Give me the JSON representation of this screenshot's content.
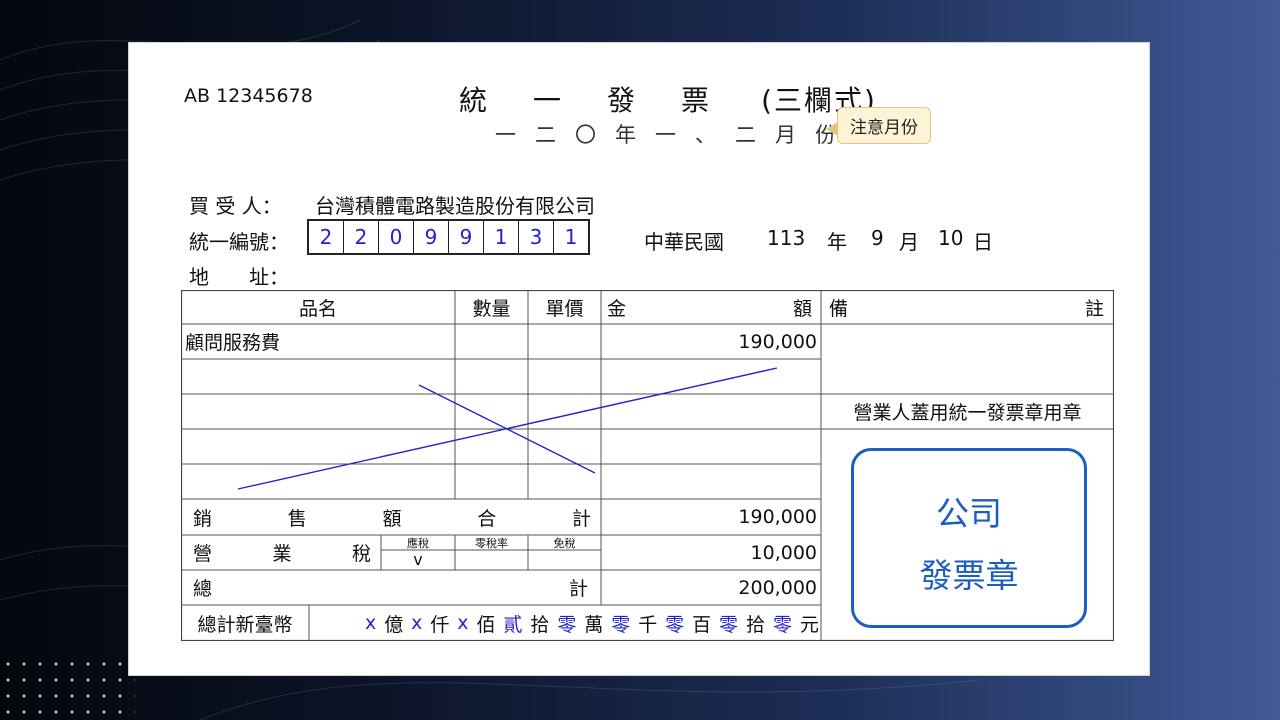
{
  "invoice": {
    "serial": "AB 12345678",
    "title_chars": [
      "統",
      "一",
      "發",
      "票"
    ],
    "title_suffix": "(三欄式)",
    "period": "一二〇年一、二月份",
    "note_tag": "注意月份"
  },
  "buyer": {
    "buyer_label": "買 受 人：",
    "buyer_name": "台灣積體電路製造股份有限公司",
    "tax_id_label": "統一編號：",
    "tax_id_digits": [
      "2",
      "2",
      "0",
      "9",
      "9",
      "1",
      "3",
      "1"
    ],
    "date_label": "中華民國",
    "year": "113",
    "year_unit": "年",
    "month": "9",
    "month_unit": "月",
    "day": "10",
    "day_unit": "日",
    "address_label": "地　　址："
  },
  "table": {
    "headers": {
      "item": "品名",
      "qty": "數量",
      "unit_price": "單價",
      "amount_left": "金",
      "amount_right": "額",
      "remark_left": "備",
      "remark_right": "註"
    },
    "rows": [
      {
        "item": "顧問服務費",
        "amount": "190,000"
      }
    ],
    "stamp_note": "營業人蓋用統一發票章用章",
    "sales_total_chars": [
      "銷",
      "售",
      "額",
      "合",
      "計"
    ],
    "sales_total": "190,000",
    "tax_label_chars": [
      "營",
      "業",
      "稅"
    ],
    "tax_types": [
      "應稅",
      "零稅率",
      "免稅"
    ],
    "tax_type_mark": "v",
    "tax_amount": "10,000",
    "grand_total_left": "總",
    "grand_total_right": "計",
    "grand_total": "200,000",
    "amount_words_label": "總計新臺幣",
    "amount_words": [
      {
        "digit": "x",
        "unit": "億"
      },
      {
        "digit": "x",
        "unit": "仟"
      },
      {
        "digit": "x",
        "unit": "佰"
      },
      {
        "digit": "貳",
        "unit": "拾"
      },
      {
        "digit": "零",
        "unit": "萬"
      },
      {
        "digit": "零",
        "unit": "千"
      },
      {
        "digit": "零",
        "unit": "百"
      },
      {
        "digit": "零",
        "unit": "拾"
      },
      {
        "digit": "零",
        "unit": "元"
      }
    ]
  },
  "stamp": {
    "line1": "公司",
    "line2": "發票章"
  },
  "colors": {
    "fill_in_text": "#2323cc",
    "stamp_border": "#1b5ec2",
    "tag_bg": "#fdf3d6"
  }
}
